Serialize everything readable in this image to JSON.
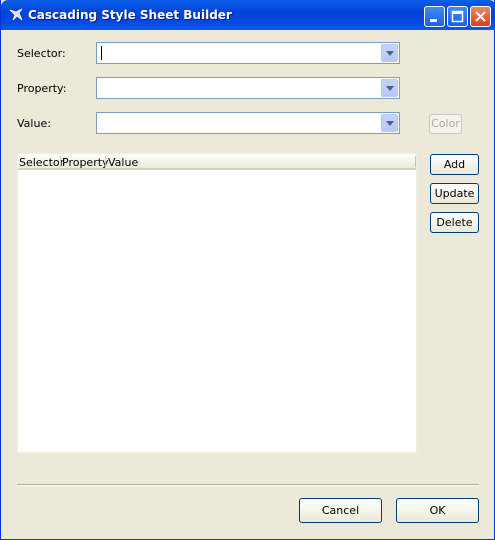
{
  "window": {
    "title": "Cascading Style Sheet Builder"
  },
  "form": {
    "selector_label": "Selector:",
    "property_label": "Property:",
    "value_label": "Value:",
    "selector_value": "",
    "property_value": "",
    "value_value": ""
  },
  "buttons": {
    "color": "Color",
    "add": "Add",
    "update": "Update",
    "delete": "Delete",
    "cancel": "Cancel",
    "ok": "OK"
  },
  "table": {
    "columns": [
      "Selector",
      "Property",
      "Value"
    ],
    "rows": []
  },
  "colors": {
    "titlebar": "#0343d8",
    "face": "#ece9d8",
    "button_border": "#003c74"
  }
}
